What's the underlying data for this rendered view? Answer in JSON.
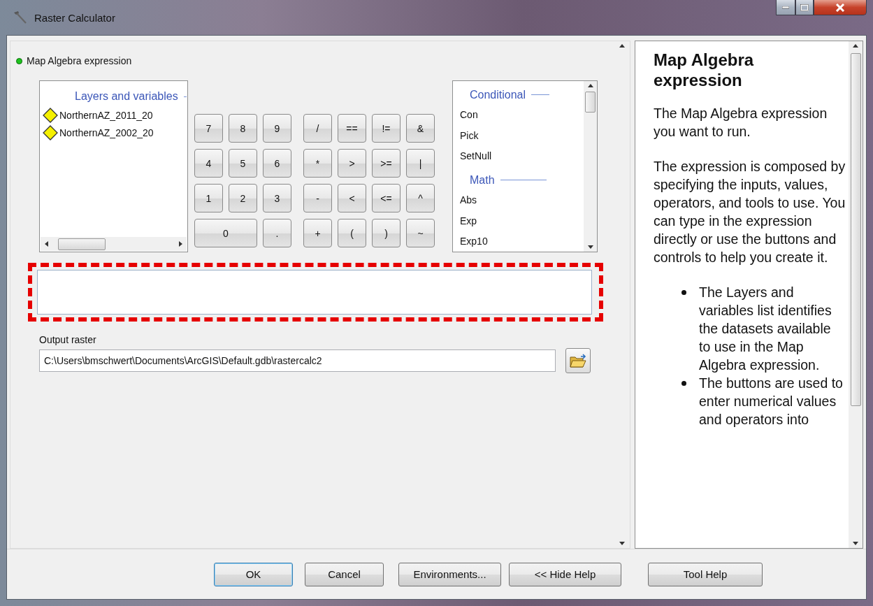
{
  "window": {
    "title": "Raster Calculator"
  },
  "expression": {
    "label": "Map Algebra expression"
  },
  "layers": {
    "title": "Layers and variables",
    "items": [
      {
        "name": "NorthernAZ_2011_20"
      },
      {
        "name": "NorthernAZ_2002_20"
      }
    ]
  },
  "keypad": {
    "digits": [
      {
        "label": "7",
        "kind": "key"
      },
      {
        "label": "8",
        "kind": "key"
      },
      {
        "label": "9",
        "kind": "key"
      },
      {
        "label": "4",
        "kind": "key"
      },
      {
        "label": "5",
        "kind": "key"
      },
      {
        "label": "6",
        "kind": "key"
      },
      {
        "label": "1",
        "kind": "key"
      },
      {
        "label": "2",
        "kind": "key"
      },
      {
        "label": "3",
        "kind": "key"
      },
      {
        "label": "0",
        "kind": "wide"
      },
      {
        "label": ".",
        "kind": "key"
      }
    ],
    "operators": [
      {
        "label": "/",
        "kind": "key"
      },
      {
        "label": "==",
        "kind": "key"
      },
      {
        "label": "!=",
        "kind": "key"
      },
      {
        "label": "&",
        "kind": "key"
      },
      {
        "label": "*",
        "kind": "key"
      },
      {
        "label": ">",
        "kind": "key"
      },
      {
        "label": ">=",
        "kind": "key"
      },
      {
        "label": "|",
        "kind": "key"
      },
      {
        "label": "-",
        "kind": "key"
      },
      {
        "label": "<",
        "kind": "key"
      },
      {
        "label": "<=",
        "kind": "key"
      },
      {
        "label": "^",
        "kind": "key"
      },
      {
        "label": "+",
        "kind": "key"
      },
      {
        "label": "(",
        "kind": "key"
      },
      {
        "label": ")",
        "kind": "key"
      },
      {
        "label": "~",
        "kind": "key"
      }
    ]
  },
  "functions": [
    {
      "group": "Conditional",
      "items": [
        "Con",
        "Pick",
        "SetNull"
      ]
    },
    {
      "group": "Math",
      "items": [
        "Abs",
        "Exp",
        "Exp10"
      ]
    }
  ],
  "output": {
    "label": "Output raster",
    "value": "C:\\Users\\bmschwert\\Documents\\ArcGIS\\Default.gdb\\rastercalc2"
  },
  "help": {
    "title": "Map Algebra expression",
    "paragraphs": [
      "The Map Algebra expression you want to run.",
      "The expression is composed by specifying the inputs, values, operators, and tools to use. You can type in the expression directly or use the buttons and controls to help you create it."
    ],
    "bullets": [
      "The Layers and variables list identifies the datasets available to use in the Map Algebra expression.",
      "The buttons are used to enter numerical values and operators into"
    ]
  },
  "buttons": [
    {
      "label": "OK",
      "selected": true
    },
    {
      "label": "Cancel",
      "selected": false
    },
    {
      "label": "Environments...",
      "selected": false
    },
    {
      "label": "<< Hide Help",
      "selected": false
    },
    {
      "label": "Tool Help",
      "selected": false
    }
  ]
}
